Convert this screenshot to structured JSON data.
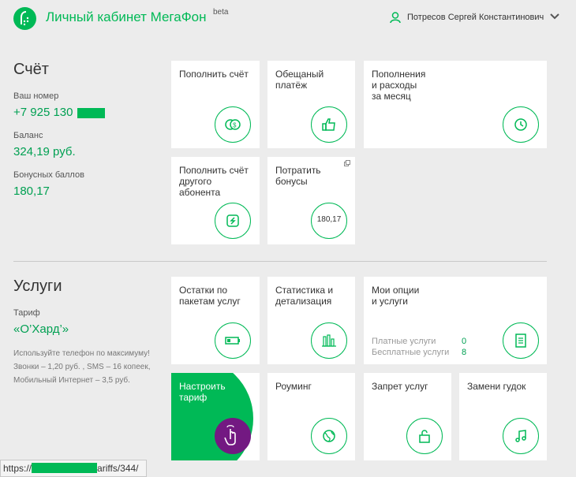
{
  "header": {
    "brand": "Личный кабинет МегаФон",
    "beta": "beta",
    "user_name": "Потресов Сергей Константинович"
  },
  "account": {
    "title": "Счёт",
    "number_label": "Ваш номер",
    "number_value": "+7 925 130",
    "balance_label": "Баланс",
    "balance_value": "324,19 руб.",
    "bonus_label": "Бонусных баллов",
    "bonus_value": "180,17"
  },
  "account_tiles": {
    "topup": "Пополнить счёт",
    "promised": "Обещаный\nплатёж",
    "monthly": "Пополнения\nи расходы\nза месяц",
    "topup_other": "Пополнить счёт\nдругого\nабонента",
    "spend_bonus": "Потратить\nбонусы",
    "spend_bonus_value": "180,17"
  },
  "services": {
    "title": "Услуги",
    "tariff_label": "Тариф",
    "tariff_value": "«О’Хард’»",
    "promo_line1": "Используйте телефон по максимуму!",
    "promo_line2": "Звонки – 1,20 руб. , SMS – 16 копеек,",
    "promo_line3": "Мобильный Интернет – 3,5 руб."
  },
  "service_tiles": {
    "remains": "Остатки по\nпакетам услуг",
    "stats": "Статистика и\nдетализация",
    "options": "Мои опции\nи услуги",
    "paid_label": "Платные услуги",
    "paid_value": "0",
    "free_label": "Бесплатные услуги",
    "free_value": "8",
    "tariff_setup": "Настроить\nтариф",
    "roaming": "Роуминг",
    "ban": "Запрет услуг",
    "ringtone": "Замени гудок"
  },
  "status_bar": {
    "prefix": "https://",
    "suffix": "ariffs/344/"
  },
  "colors": {
    "brand_green": "#00b956",
    "purple": "#731982",
    "background": "#ececec"
  }
}
